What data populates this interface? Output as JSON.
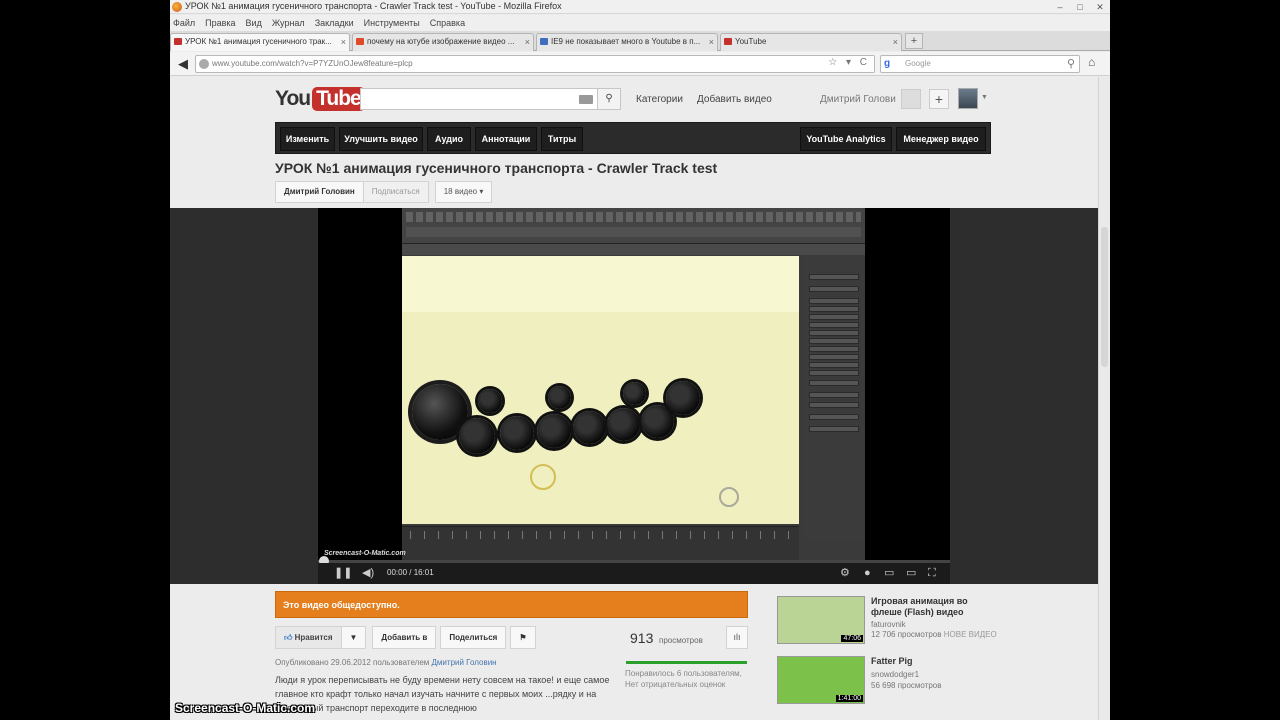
{
  "window": {
    "title": "УРОК №1 анимация гусеничного транспорта - Crawler Track test - YouTube - Mozilla Firefox",
    "controls": [
      "–",
      "□",
      "✕"
    ]
  },
  "menu": [
    "Файл",
    "Правка",
    "Вид",
    "Журнал",
    "Закладки",
    "Инструменты",
    "Справка"
  ],
  "tabs": [
    {
      "label": "УРОК №1 анимация гусеничного трак...",
      "icon_color": "#c4302b",
      "active": true
    },
    {
      "label": "почему на ютубе изображение видео ...",
      "icon_color": "#e04a2a",
      "active": false
    },
    {
      "label": "IE9 не показывает много в Youtube в п...",
      "icon_color": "#3c6ebd",
      "active": false
    },
    {
      "label": "YouTube",
      "icon_color": "#c4302b",
      "active": false
    }
  ],
  "tab_close": "×",
  "new_tab": "+",
  "nav": {
    "back": "◀",
    "url": "www.youtube.com/watch?v=P7YZUnOJew8feature=plcp",
    "url_icons": "☆ ▾ C",
    "search_engine": "g",
    "search_placeholder": "Google",
    "search_icon": "⚲",
    "home": "⌂"
  },
  "youtube": {
    "logo_you": "You",
    "logo_tube": "Tube",
    "search_button": "⚲",
    "links": [
      "Категории",
      "Добавить видео"
    ],
    "user_name": "Дмитрий Голови",
    "plus": "+",
    "edit_buttons": [
      "Изменить",
      "Улучшить видео",
      "Аудио",
      "Аннотации",
      "Титры"
    ],
    "right_buttons": [
      "YouTube Analytics",
      "Менеджер видео"
    ],
    "video_title": "УРОК №1 анимация гусеничного транспорта - Crawler Track test",
    "channel_name": "Дмитрий Головин",
    "subscribe": "Подписаться",
    "video_count": "18 видео ▾",
    "player": {
      "watermark": "Screencast-O-Matic.com",
      "time": "00:00 / 16:01",
      "progress": 0
    },
    "public_banner": "Это видео общедоступно.",
    "actions": {
      "like": "Нравится",
      "dislike": "",
      "add_to": "Добавить в",
      "share": "Поделиться",
      "flag": "⚑"
    },
    "views": "913",
    "views_label": "просмотров",
    "likes_text": "Понравилось 6 пользователям, Нет отрицательных оценок",
    "likes_ratio": 1.0,
    "published_prefix": "Опубликовано 29.06.2012 пользователем",
    "published_user": "Дмитрий Головин",
    "description": "Люди я урок переписывать не буду времени нету совсем на такое! и еще самое главное кто крафт только начал изучать начните с первых моих ...рядку и на гусеничный транспорт переходите в последнюю",
    "related": [
      {
        "title": "Игровая анимация во флеше (Flash) видео",
        "channel": "faturovnik",
        "views": "12 706 просмотров",
        "badge": "НОВЕ ВИДЕО",
        "duration": "47:06",
        "thumb_color": "#b9d495"
      },
      {
        "title": "Fatter Pig",
        "channel": "snowdodger1",
        "views": "56 698 просмотров",
        "badge": "",
        "duration": "1:41:00",
        "thumb_color": "#7cc24a"
      }
    ]
  },
  "screen_watermark": "Screencast-O-Matic.com"
}
